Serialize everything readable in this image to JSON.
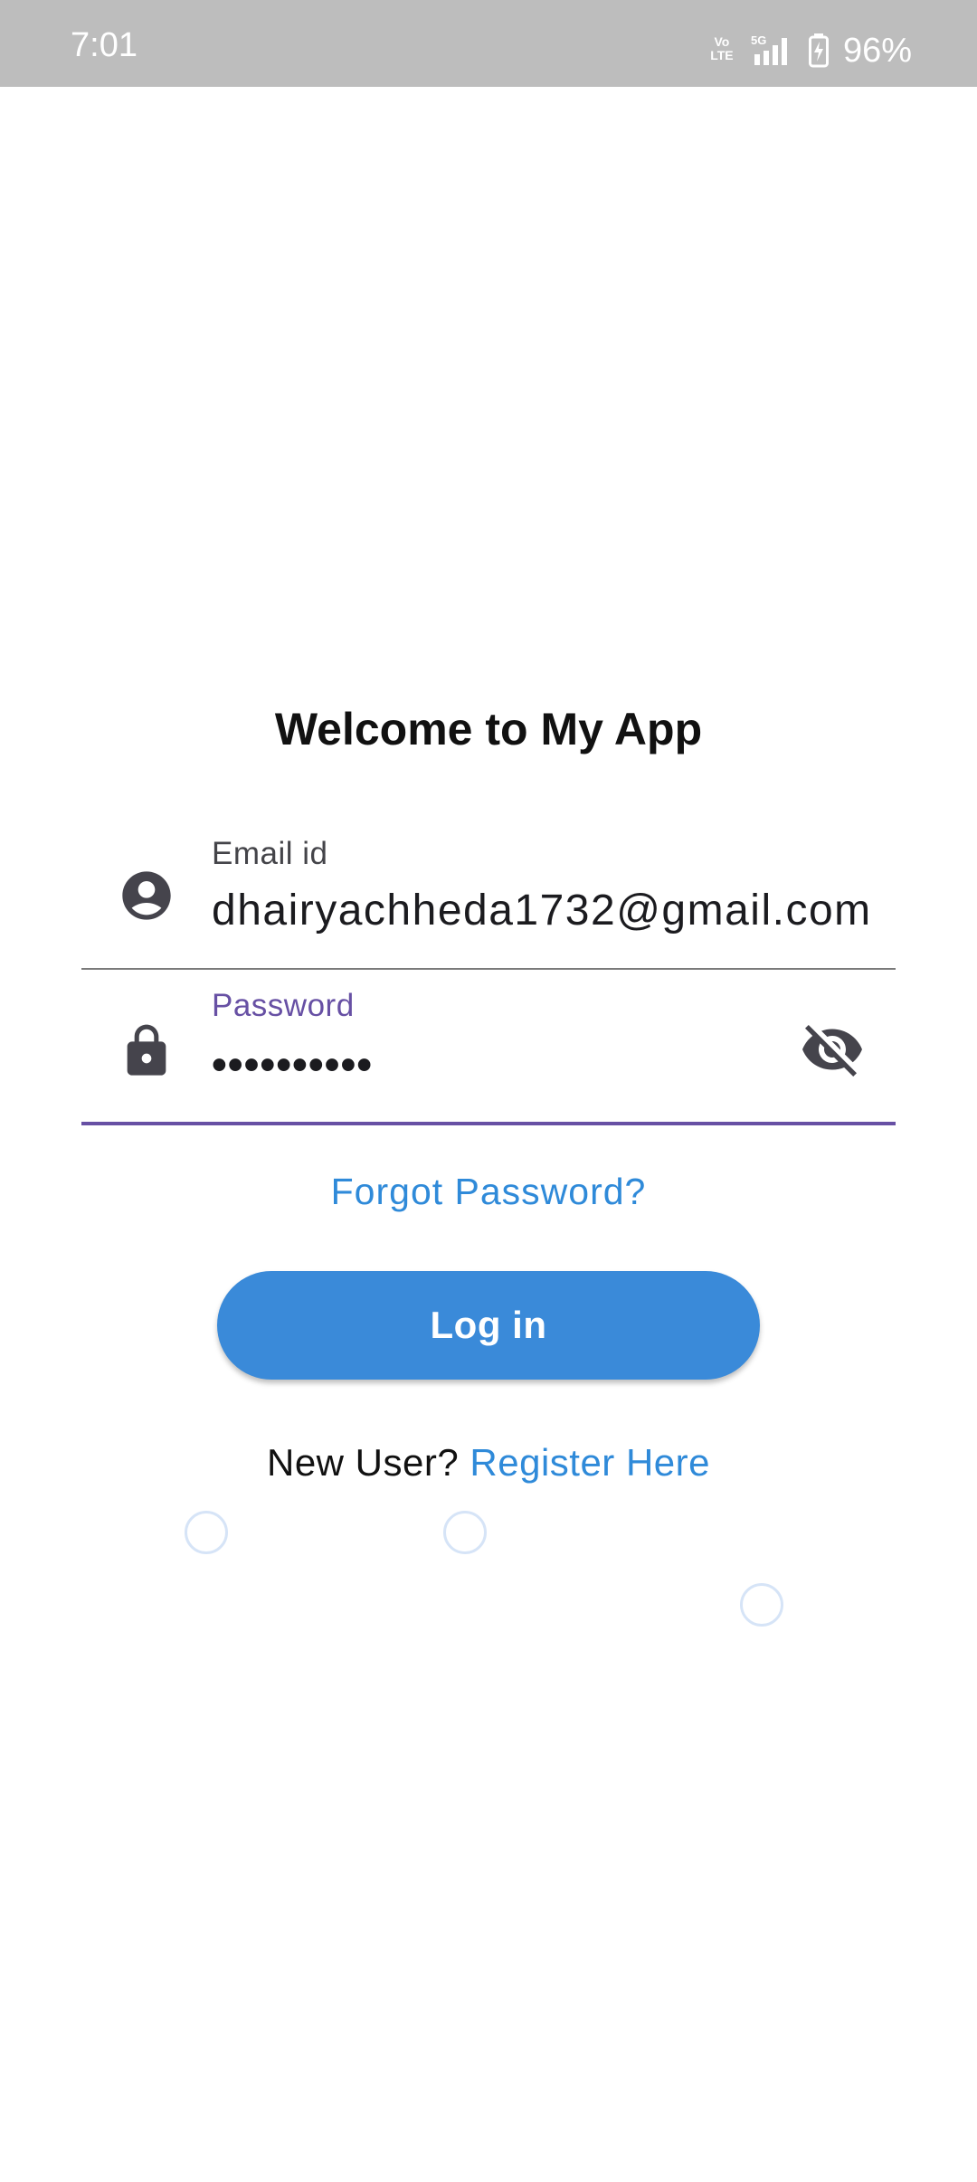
{
  "status_bar": {
    "time": "7:01",
    "volte_line1": "Vo",
    "volte_line2": "LTE",
    "network": "5G",
    "battery": "96%"
  },
  "screen": {
    "title": "Welcome to My App"
  },
  "email_field": {
    "label": "Email id",
    "value": "dhairyachheda1732@gmail.com",
    "icon": "account-circle-icon"
  },
  "password_field": {
    "label": "Password",
    "value": "••••••••••",
    "icon": "lock-icon",
    "visibility_icon": "visibility-off-icon"
  },
  "forgot_password": {
    "label": "Forgot Password?"
  },
  "login_button": {
    "label": "Log in"
  },
  "register": {
    "prompt": "New User?",
    "link": "Register Here"
  },
  "colors": {
    "status_bar": "#bdbdbd",
    "primary_button": "#3a8ad9",
    "link": "#2f8ad9",
    "focus_accent": "#6750a4",
    "icon": "#45444c"
  }
}
